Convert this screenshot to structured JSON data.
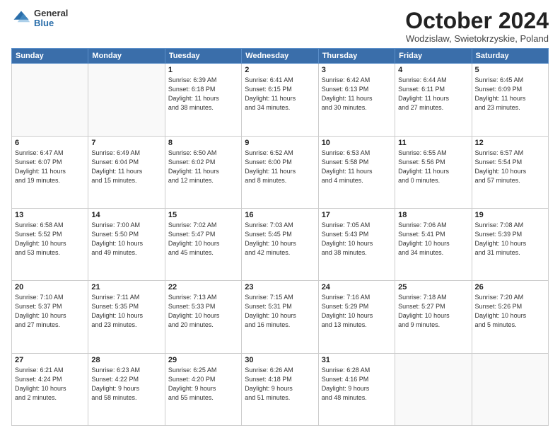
{
  "header": {
    "logo_general": "General",
    "logo_blue": "Blue",
    "month_title": "October 2024",
    "location": "Wodzislaw, Swietokrzyskie, Poland"
  },
  "weekdays": [
    "Sunday",
    "Monday",
    "Tuesday",
    "Wednesday",
    "Thursday",
    "Friday",
    "Saturday"
  ],
  "weeks": [
    [
      {
        "day": "",
        "info": ""
      },
      {
        "day": "",
        "info": ""
      },
      {
        "day": "1",
        "info": "Sunrise: 6:39 AM\nSunset: 6:18 PM\nDaylight: 11 hours\nand 38 minutes."
      },
      {
        "day": "2",
        "info": "Sunrise: 6:41 AM\nSunset: 6:15 PM\nDaylight: 11 hours\nand 34 minutes."
      },
      {
        "day": "3",
        "info": "Sunrise: 6:42 AM\nSunset: 6:13 PM\nDaylight: 11 hours\nand 30 minutes."
      },
      {
        "day": "4",
        "info": "Sunrise: 6:44 AM\nSunset: 6:11 PM\nDaylight: 11 hours\nand 27 minutes."
      },
      {
        "day": "5",
        "info": "Sunrise: 6:45 AM\nSunset: 6:09 PM\nDaylight: 11 hours\nand 23 minutes."
      }
    ],
    [
      {
        "day": "6",
        "info": "Sunrise: 6:47 AM\nSunset: 6:07 PM\nDaylight: 11 hours\nand 19 minutes."
      },
      {
        "day": "7",
        "info": "Sunrise: 6:49 AM\nSunset: 6:04 PM\nDaylight: 11 hours\nand 15 minutes."
      },
      {
        "day": "8",
        "info": "Sunrise: 6:50 AM\nSunset: 6:02 PM\nDaylight: 11 hours\nand 12 minutes."
      },
      {
        "day": "9",
        "info": "Sunrise: 6:52 AM\nSunset: 6:00 PM\nDaylight: 11 hours\nand 8 minutes."
      },
      {
        "day": "10",
        "info": "Sunrise: 6:53 AM\nSunset: 5:58 PM\nDaylight: 11 hours\nand 4 minutes."
      },
      {
        "day": "11",
        "info": "Sunrise: 6:55 AM\nSunset: 5:56 PM\nDaylight: 11 hours\nand 0 minutes."
      },
      {
        "day": "12",
        "info": "Sunrise: 6:57 AM\nSunset: 5:54 PM\nDaylight: 10 hours\nand 57 minutes."
      }
    ],
    [
      {
        "day": "13",
        "info": "Sunrise: 6:58 AM\nSunset: 5:52 PM\nDaylight: 10 hours\nand 53 minutes."
      },
      {
        "day": "14",
        "info": "Sunrise: 7:00 AM\nSunset: 5:50 PM\nDaylight: 10 hours\nand 49 minutes."
      },
      {
        "day": "15",
        "info": "Sunrise: 7:02 AM\nSunset: 5:47 PM\nDaylight: 10 hours\nand 45 minutes."
      },
      {
        "day": "16",
        "info": "Sunrise: 7:03 AM\nSunset: 5:45 PM\nDaylight: 10 hours\nand 42 minutes."
      },
      {
        "day": "17",
        "info": "Sunrise: 7:05 AM\nSunset: 5:43 PM\nDaylight: 10 hours\nand 38 minutes."
      },
      {
        "day": "18",
        "info": "Sunrise: 7:06 AM\nSunset: 5:41 PM\nDaylight: 10 hours\nand 34 minutes."
      },
      {
        "day": "19",
        "info": "Sunrise: 7:08 AM\nSunset: 5:39 PM\nDaylight: 10 hours\nand 31 minutes."
      }
    ],
    [
      {
        "day": "20",
        "info": "Sunrise: 7:10 AM\nSunset: 5:37 PM\nDaylight: 10 hours\nand 27 minutes."
      },
      {
        "day": "21",
        "info": "Sunrise: 7:11 AM\nSunset: 5:35 PM\nDaylight: 10 hours\nand 23 minutes."
      },
      {
        "day": "22",
        "info": "Sunrise: 7:13 AM\nSunset: 5:33 PM\nDaylight: 10 hours\nand 20 minutes."
      },
      {
        "day": "23",
        "info": "Sunrise: 7:15 AM\nSunset: 5:31 PM\nDaylight: 10 hours\nand 16 minutes."
      },
      {
        "day": "24",
        "info": "Sunrise: 7:16 AM\nSunset: 5:29 PM\nDaylight: 10 hours\nand 13 minutes."
      },
      {
        "day": "25",
        "info": "Sunrise: 7:18 AM\nSunset: 5:27 PM\nDaylight: 10 hours\nand 9 minutes."
      },
      {
        "day": "26",
        "info": "Sunrise: 7:20 AM\nSunset: 5:26 PM\nDaylight: 10 hours\nand 5 minutes."
      }
    ],
    [
      {
        "day": "27",
        "info": "Sunrise: 6:21 AM\nSunset: 4:24 PM\nDaylight: 10 hours\nand 2 minutes."
      },
      {
        "day": "28",
        "info": "Sunrise: 6:23 AM\nSunset: 4:22 PM\nDaylight: 9 hours\nand 58 minutes."
      },
      {
        "day": "29",
        "info": "Sunrise: 6:25 AM\nSunset: 4:20 PM\nDaylight: 9 hours\nand 55 minutes."
      },
      {
        "day": "30",
        "info": "Sunrise: 6:26 AM\nSunset: 4:18 PM\nDaylight: 9 hours\nand 51 minutes."
      },
      {
        "day": "31",
        "info": "Sunrise: 6:28 AM\nSunset: 4:16 PM\nDaylight: 9 hours\nand 48 minutes."
      },
      {
        "day": "",
        "info": ""
      },
      {
        "day": "",
        "info": ""
      }
    ]
  ]
}
